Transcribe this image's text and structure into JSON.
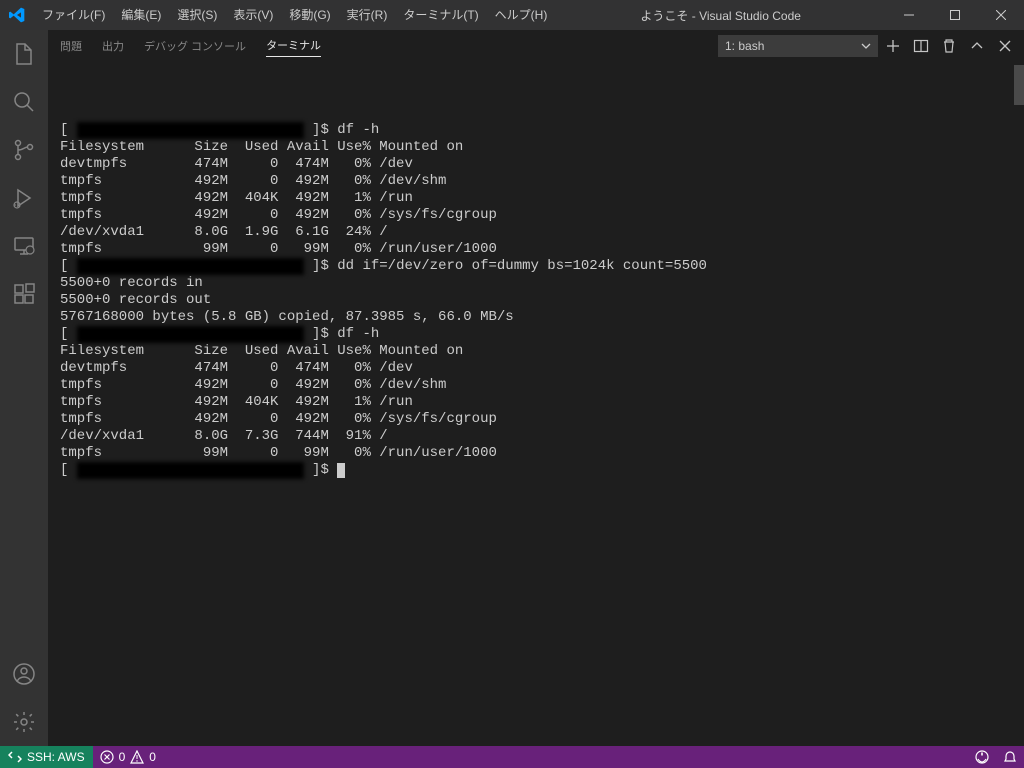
{
  "titlebar": {
    "title": "ようこそ - Visual Studio Code",
    "menu": [
      "ファイル(F)",
      "編集(E)",
      "選択(S)",
      "表示(V)",
      "移動(G)",
      "実行(R)",
      "ターミナル(T)",
      "ヘルプ(H)"
    ]
  },
  "panel": {
    "tabs": [
      "問題",
      "出力",
      "デバッグ コンソール",
      "ターミナル"
    ],
    "activeTab": "ターミナル",
    "terminalSelector": "1: bash"
  },
  "terminal": {
    "lines": [
      "[                             ]$ df -h",
      "Filesystem      Size  Used Avail Use% Mounted on",
      "devtmpfs        474M     0  474M   0% /dev",
      "tmpfs           492M     0  492M   0% /dev/shm",
      "tmpfs           492M  404K  492M   1% /run",
      "tmpfs           492M     0  492M   0% /sys/fs/cgroup",
      "/dev/xvda1      8.0G  1.9G  6.1G  24% /",
      "tmpfs            99M     0   99M   0% /run/user/1000",
      "[                             ]$ dd if=/dev/zero of=dummy bs=1024k count=5500",
      "5500+0 records in",
      "5500+0 records out",
      "5767168000 bytes (5.8 GB) copied, 87.3985 s, 66.0 MB/s",
      "[                             ]$ df -h",
      "Filesystem      Size  Used Avail Use% Mounted on",
      "devtmpfs        474M     0  474M   0% /dev",
      "tmpfs           492M     0  492M   0% /dev/shm",
      "tmpfs           492M  404K  492M   1% /run",
      "tmpfs           492M     0  492M   0% /sys/fs/cgroup",
      "/dev/xvda1      8.0G  7.3G  744M  91% /",
      "tmpfs            99M     0   99M   0% /run/user/1000",
      "[                             ]$ "
    ]
  },
  "statusbar": {
    "remote": "SSH: AWS",
    "errors": "0",
    "warnings": "0"
  }
}
